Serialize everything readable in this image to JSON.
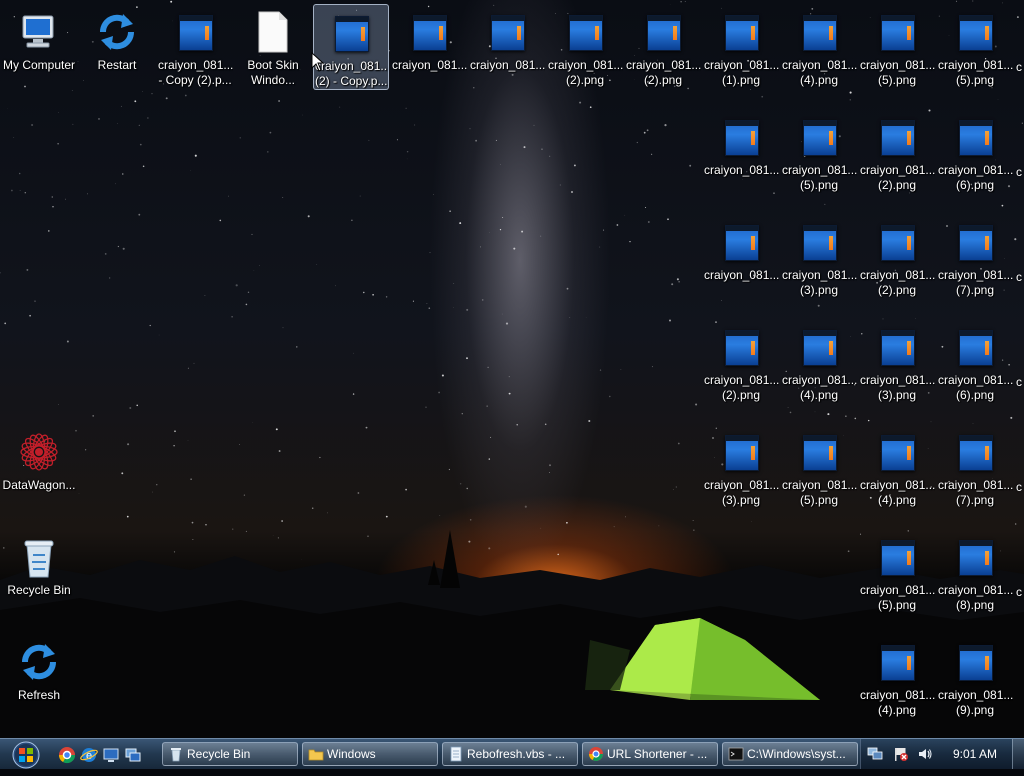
{
  "desktop": {
    "icons": [
      {
        "label": "My Computer",
        "kind": "computer-icon"
      },
      {
        "label": "Restart",
        "kind": "restart-icon"
      },
      {
        "label": "craiyon_081...\n- Copy (2).p...",
        "kind": "image-thumbnail"
      },
      {
        "label": "Boot Skin\nWindo...",
        "kind": "document-icon"
      },
      {
        "label": "craiyon_081...\n(2) - Copy.p...",
        "kind": "image-thumbnail",
        "selected": true
      },
      {
        "label": "craiyon_081...",
        "kind": "image-thumbnail"
      },
      {
        "label": "craiyon_081...",
        "kind": "image-thumbnail"
      },
      {
        "label": "craiyon_081...\n(2).png",
        "kind": "image-thumbnail"
      },
      {
        "label": "craiyon_081...\n(2).png",
        "kind": "image-thumbnail"
      },
      {
        "label": "craiyon_081...\n(1).png",
        "kind": "image-thumbnail"
      },
      {
        "label": "craiyon_081...\n(4).png",
        "kind": "image-thumbnail"
      },
      {
        "label": "craiyon_081...\n(5).png",
        "kind": "image-thumbnail"
      },
      {
        "label": "craiyon_081...\n(5).png",
        "kind": "image-thumbnail"
      },
      {
        "label": "craiyon_081...",
        "kind": "image-thumbnail"
      },
      {
        "label": "craiyon_081...\n(5).png",
        "kind": "image-thumbnail"
      },
      {
        "label": "craiyon_081...\n(2).png",
        "kind": "image-thumbnail"
      },
      {
        "label": "craiyon_081...\n(6).png",
        "kind": "image-thumbnail"
      },
      {
        "label": "craiyon_081...",
        "kind": "image-thumbnail"
      },
      {
        "label": "craiyon_081...\n(3).png",
        "kind": "image-thumbnail"
      },
      {
        "label": "craiyon_081...\n(2).png",
        "kind": "image-thumbnail"
      },
      {
        "label": "craiyon_081...\n(7).png",
        "kind": "image-thumbnail"
      },
      {
        "label": "craiyon_081...\n(2).png",
        "kind": "image-thumbnail"
      },
      {
        "label": "craiyon_081...\n(4).png",
        "kind": "image-thumbnail"
      },
      {
        "label": "craiyon_081...\n(3).png",
        "kind": "image-thumbnail"
      },
      {
        "label": "craiyon_081...\n(6).png",
        "kind": "image-thumbnail"
      },
      {
        "label": "DataWagon...",
        "kind": "datawagon-icon"
      },
      {
        "label": "craiyon_081...\n(3).png",
        "kind": "image-thumbnail"
      },
      {
        "label": "craiyon_081...\n(5).png",
        "kind": "image-thumbnail"
      },
      {
        "label": "craiyon_081...\n(4).png",
        "kind": "image-thumbnail"
      },
      {
        "label": "craiyon_081...\n(7).png",
        "kind": "image-thumbnail"
      },
      {
        "label": "Recycle Bin",
        "kind": "recycle-bin-icon"
      },
      {
        "label": "craiyon_081...\n(5).png",
        "kind": "image-thumbnail"
      },
      {
        "label": "craiyon_081...\n(8).png",
        "kind": "image-thumbnail"
      },
      {
        "label": "Refresh",
        "kind": "refresh-icon"
      },
      {
        "label": "craiyon_081...\n(4).png",
        "kind": "image-thumbnail"
      },
      {
        "label": "craiyon_081...\n(9).png",
        "kind": "image-thumbnail"
      }
    ],
    "edge_labels": [
      "c",
      "c",
      "c",
      "c",
      "c",
      "c"
    ]
  },
  "taskbar": {
    "start_icon": "windows-orb-icon",
    "quick_launch": [
      "chrome-icon",
      "internet-explorer-icon",
      "computer-icon",
      "window-switch-icon"
    ],
    "tasks": [
      {
        "label": "Recycle Bin",
        "icon": "recycle-bin-icon"
      },
      {
        "label": "Windows",
        "icon": "folder-icon"
      },
      {
        "label": "Rebofresh.vbs - ...",
        "icon": "notepad-icon"
      },
      {
        "label": "URL Shortener - ...",
        "icon": "chrome-icon"
      },
      {
        "label": "C:\\Windows\\syst...",
        "icon": "cmd-icon"
      }
    ],
    "tray_icons": [
      "network-icon",
      "flag-alert-icon",
      "volume-icon"
    ],
    "clock": "9:01 AM"
  },
  "colors": {
    "taskbar_top": "#3a5675",
    "taskbar_bottom": "#17283a",
    "thumbnail_blue": "#2a7de0",
    "tent_green": "#9be23a"
  }
}
